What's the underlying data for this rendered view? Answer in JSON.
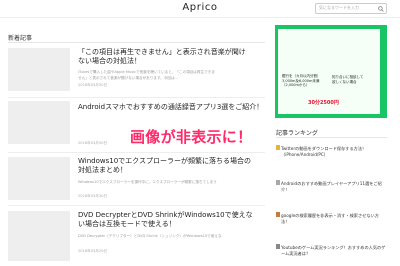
{
  "header": {
    "logo": "Aprico",
    "search_placeholder": "気になるワードを入力"
  },
  "main": {
    "heading": "新着記事",
    "articles": [
      {
        "title_line1": "「この項目は再生できません」と表示され音楽が聞け",
        "title_line2": "ない場合の対処法！",
        "excerpt_line1": "iTunesで購入した曲やApple Musicで音楽を聴いていると、「この項目は再生できま",
        "excerpt_line2": "せん」と表示されて音楽が聞けない場合があります。今回は...",
        "date": "2018年03月30日"
      },
      {
        "title": "Androidスマホでおすすめの通話録音アプリ3選をご紹介！",
        "excerpt_line1": "",
        "excerpt_line2": "",
        "date": "2018年03月30日"
      },
      {
        "title_line1": "Windows10でエクスプローラーが頻繁に落ちる場合の",
        "title_line2": "対処法まとめ！",
        "excerpt_line1": "Windows10でエクスプローラーを操作中に、エクスプローラーが頻繁に落ちてしまう",
        "excerpt_line2": "",
        "date": "2018年03月30日"
      },
      {
        "title_line1": "DVD DecrypterとDVD ShrinkがWindows10で使えな",
        "title_line2": "い場合は互換モードで使える！",
        "excerpt_line1": "DVD Decrypter（デクリプター）とDVD Shrink（シュリンク）がWindows10で使えな",
        "date": "2018年03月29日"
      }
    ]
  },
  "overlay": {
    "text": "画像が非表示に！"
  },
  "sidebar": {
    "ad": {
      "text_line1": "銀行を（カ月以内分割）",
      "text_line2": "3,000m及6,000m未満",
      "text_line3": "（2,000mから）",
      "text_right_line1": "知り合いに相談して",
      "text_right_line2": "欲しくない場合",
      "price": "30分2500円"
    },
    "ranking_title": "記事ランキング",
    "ranking": [
      {
        "text": "Twitterの動画をダウンロード保存する方法！（iPhone/Android/PC）",
        "color": "#e8b33b"
      },
      {
        "text": "Androidのおすすめ動画プレイヤーアプリ11選をご紹介！",
        "color": "#a8a8a8"
      },
      {
        "text": "googleの検索履歴を非表示・消す・検索させない方法！",
        "color": "#c97a3a"
      },
      {
        "text": "Youtubeのゲーム実況ランキング！おすすめの人気のゲーム実況者は？",
        "color": "#888888"
      }
    ]
  }
}
